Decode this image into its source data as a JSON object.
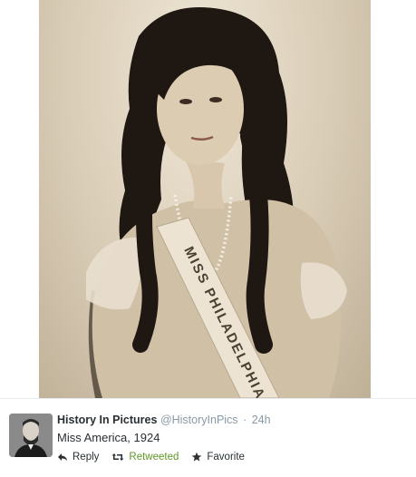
{
  "tweet": {
    "author_name": "History In Pictures",
    "handle": "@HistoryInPics",
    "separator": "·",
    "time": "24h",
    "text": "Miss America, 1924"
  },
  "actions": {
    "reply_label": "Reply",
    "retweet_label": "Retweeted",
    "favorite_label": "Favorite"
  },
  "photo": {
    "sash_text": "MISS PHILADELPHIA"
  },
  "icons": {
    "reply": "reply-arrow-icon",
    "retweet": "retweet-icon",
    "favorite": "star-icon"
  },
  "colors": {
    "retweeted": "#609928",
    "muted": "#8899a6",
    "text": "#292f33"
  }
}
